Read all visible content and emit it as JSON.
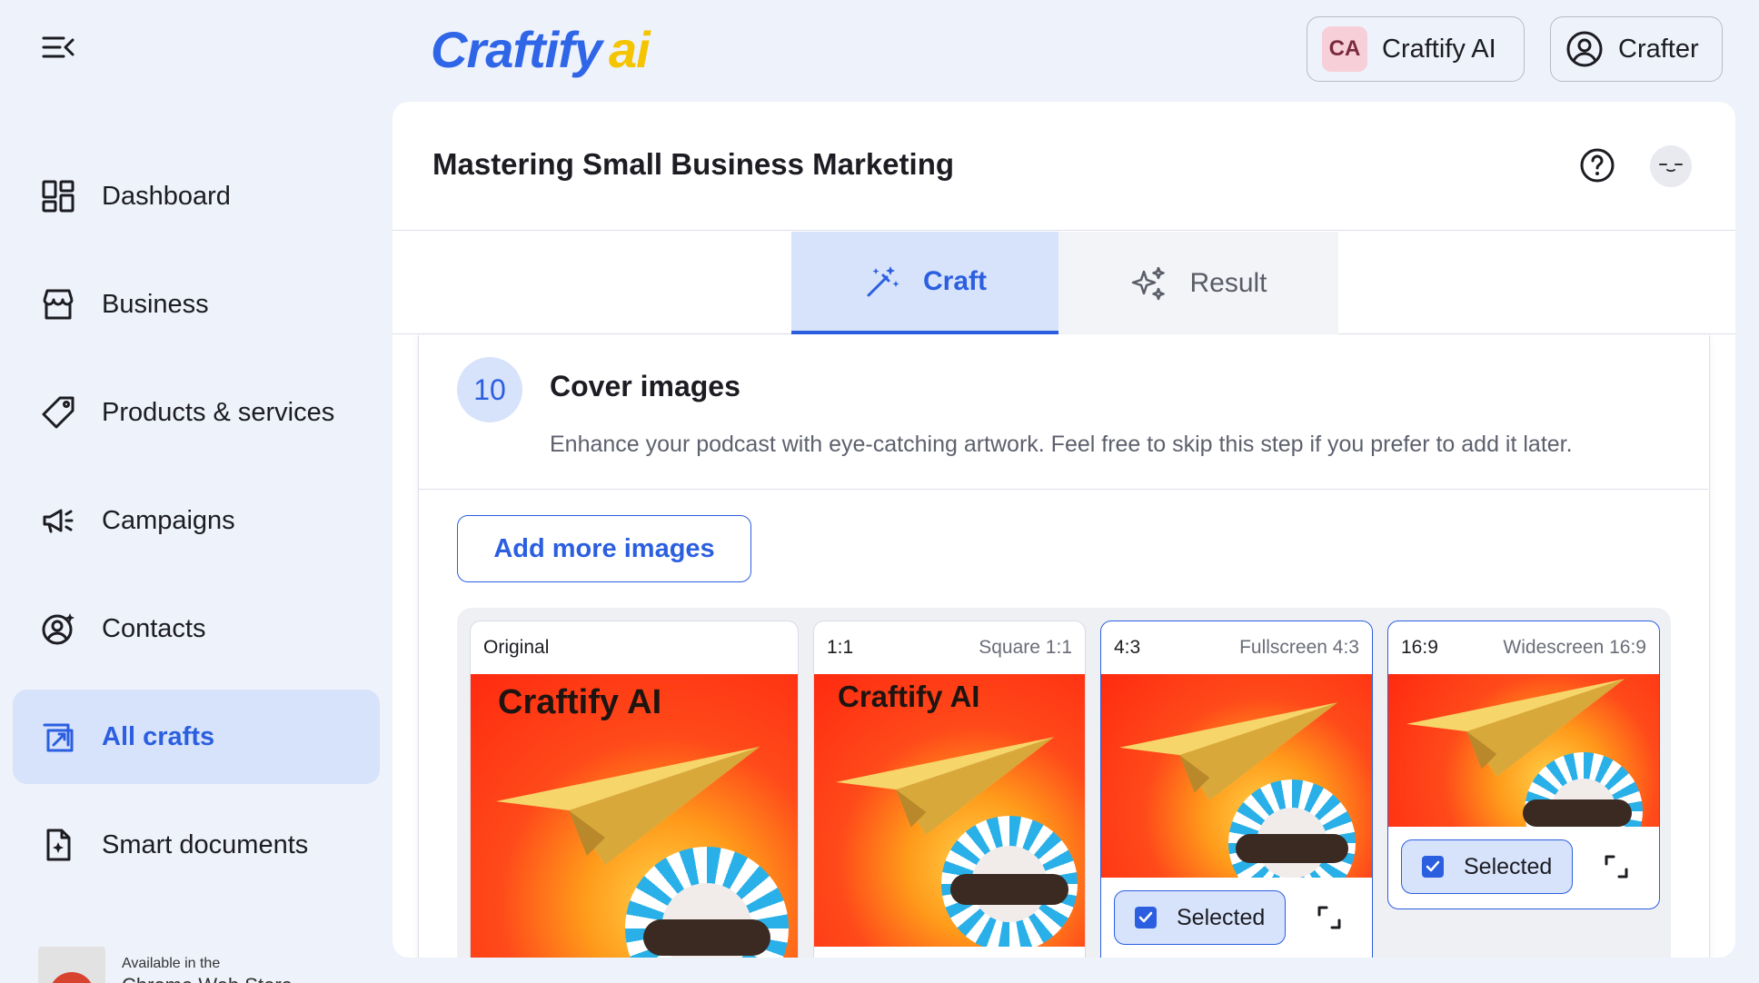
{
  "brand": {
    "part1": "Craftify",
    "part2": "ai"
  },
  "header": {
    "org": {
      "initials": "CA",
      "name": "Craftify AI"
    },
    "user": {
      "name": "Crafter"
    }
  },
  "sidebar": {
    "items": [
      {
        "label": "Dashboard",
        "icon": "dashboard-icon",
        "active": false
      },
      {
        "label": "Business",
        "icon": "store-icon",
        "active": false
      },
      {
        "label": "Products & services",
        "icon": "tag-icon",
        "active": false
      },
      {
        "label": "Campaigns",
        "icon": "megaphone-icon",
        "active": false
      },
      {
        "label": "Contacts",
        "icon": "contact-icon",
        "active": false
      },
      {
        "label": "All crafts",
        "icon": "crafts-icon",
        "active": true
      },
      {
        "label": "Smart documents",
        "icon": "smart-document-icon",
        "active": false
      }
    ],
    "store_badge": {
      "small": "Available in the",
      "big": "Chrome Web Store"
    }
  },
  "page": {
    "title": "Mastering Small Business Marketing"
  },
  "tabs": [
    {
      "label": "Craft",
      "active": true
    },
    {
      "label": "Result",
      "active": false
    }
  ],
  "step": {
    "number": "10",
    "title": "Cover images",
    "description": "Enhance your podcast with eye-catching artwork. Feel free to skip this step if you prefer to add it later."
  },
  "add_button": "Add more images",
  "images": [
    {
      "ratio": "Original",
      "label": "",
      "overlay_text": "Craftify AI",
      "selected": false
    },
    {
      "ratio": "1:1",
      "label": "Square 1:1",
      "overlay_text": "Craftify AI",
      "selected": false
    },
    {
      "ratio": "4:3",
      "label": "Fullscreen 4:3",
      "overlay_text": "",
      "selected": true,
      "selected_label": "Selected"
    },
    {
      "ratio": "16:9",
      "label": "Widescreen 16:9",
      "overlay_text": "",
      "selected": true,
      "selected_label": "Selected"
    }
  ],
  "colors": {
    "accent": "#2b5fe0",
    "accent_light": "#d7e3fb",
    "brand_blue": "#2f66e8",
    "brand_yellow": "#f5c400"
  }
}
